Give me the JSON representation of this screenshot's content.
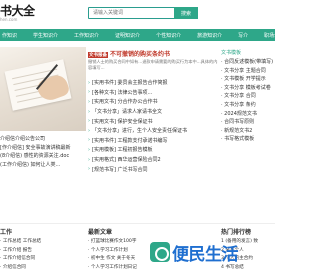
{
  "site": {
    "logo": "书大全",
    "logo_sub": "hen.com"
  },
  "search": {
    "placeholder": "请输入关键词",
    "button": "搜索"
  },
  "nav": [
    "作知识",
    "学生知识介",
    "工作知识介",
    "证明知识介",
    "个性知识介",
    "旅游知识介",
    "写介",
    "职场介绍信"
  ],
  "hero": {
    "list": [
      "介绍信介绍公告公司",
      "[作介绍信] 安全事故演讲稿最新",
      "(8介绍信) 感性的资源关注.doc",
      "(工作介绍信) 如何让人类..."
    ]
  },
  "headline": {
    "badge": "文书报备",
    "text": "不可撤销的购买条约书"
  },
  "summary": "撤销人士的购买合同中如有...退款申请需要的购买行为本中...具体的内容填写...",
  "mid_lines": [
    "[实用书件] 委员会主报告合作简报",
    "[各种文书] 法律公告事项...",
    "[实用文书] 分合作办公合作书",
    "「文书分享」请求人家请书全文",
    "[实用文书] 保护安全保证书",
    "「文书分享」进行，生个人安全责任保证书",
    "[实用书件] 工程款支付承诺书编写",
    "[实用模板] 工程初报告模板",
    "[实用格式] 西华运营保险合同2",
    "[规范书写] 广泛书写合同"
  ],
  "right": {
    "title": "文书模板",
    "lines": [
      "· 合同反述模板(带填写)",
      "· 文书分享 主题合同",
      "· 文书模板 开学提示",
      "· 文书分享 模板考试卷",
      "· 文书分享 合同",
      "· 文书分享 条约",
      "· 2024规范文书",
      "· 合同书写原则",
      "· 新规范文书2",
      "· 书写格式模板"
    ]
  },
  "bottom": {
    "left_title": "工作",
    "mid_title": "最新文章",
    "right_title": "热门排行榜",
    "left": [
      "· 工作总结 工作总结",
      "· 工作介绍 报告",
      "· 工作介绍信合同",
      "· 介绍信合同"
    ],
    "mid": [
      "· 打篮球比赛作文100字",
      "· 个人学习工作计划",
      "· 初中生 作文 关于冬天",
      "· 个人学习工作计划日记"
    ],
    "right": [
      "1  (备用的发言) 致",
      "2  某某个人",
      "3  个人的主合约",
      "4  书写总结"
    ]
  },
  "watermark": "便民生活"
}
